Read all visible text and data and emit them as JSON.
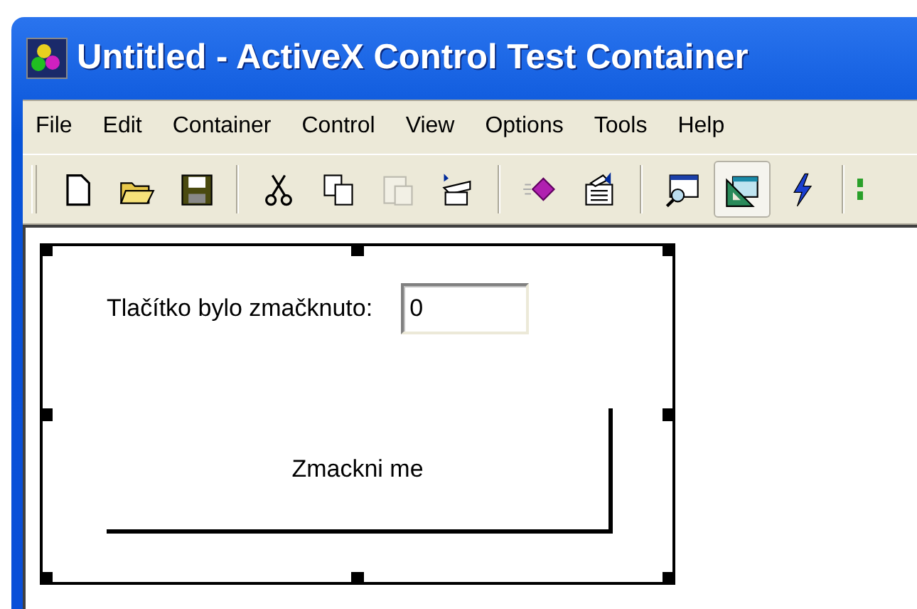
{
  "window": {
    "title": "Untitled - ActiveX Control Test Container"
  },
  "menu": [
    {
      "label": "File"
    },
    {
      "label": "Edit"
    },
    {
      "label": "Container"
    },
    {
      "label": "Control"
    },
    {
      "label": "View"
    },
    {
      "label": "Options"
    },
    {
      "label": "Tools"
    },
    {
      "label": "Help"
    }
  ],
  "toolbar": [
    [
      {
        "kind": "new",
        "pressed": false,
        "disabled": false
      },
      {
        "kind": "open",
        "pressed": false,
        "disabled": false
      },
      {
        "kind": "save",
        "pressed": false,
        "disabled": false
      }
    ],
    [
      {
        "kind": "cut",
        "pressed": false,
        "disabled": false
      },
      {
        "kind": "copy",
        "pressed": false,
        "disabled": false
      },
      {
        "kind": "paste",
        "pressed": false,
        "disabled": true
      },
      {
        "kind": "hat",
        "pressed": false,
        "disabled": false
      }
    ],
    [
      {
        "kind": "insert",
        "pressed": false,
        "disabled": false
      },
      {
        "kind": "properties",
        "pressed": false,
        "disabled": false
      }
    ],
    [
      {
        "kind": "window",
        "pressed": false,
        "disabled": false
      },
      {
        "kind": "design",
        "pressed": true,
        "disabled": false
      },
      {
        "kind": "bolt",
        "pressed": false,
        "disabled": false
      }
    ],
    [
      {
        "kind": "green",
        "pressed": false,
        "disabled": false
      }
    ]
  ],
  "control": {
    "label": "Tlačítko bylo zmačknuto:",
    "counter": "0",
    "button": "Zmackni me"
  }
}
